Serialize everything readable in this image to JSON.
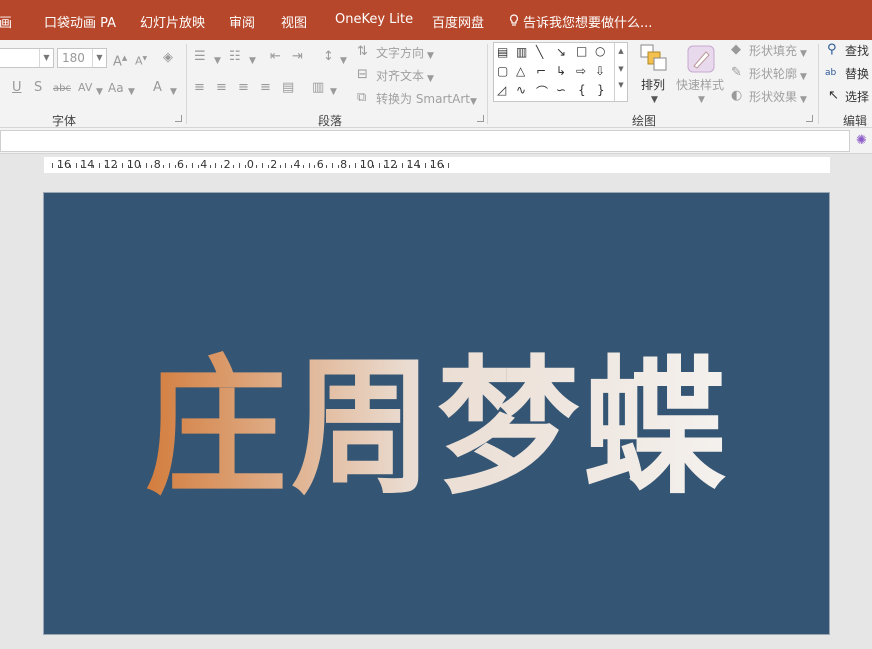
{
  "tabs": [
    "画",
    "口袋动画 PA",
    "幻灯片放映",
    "审阅",
    "视图",
    "OneKey Lite",
    "百度网盘"
  ],
  "tell_me": "告诉我您想要做什么...",
  "font": {
    "size_value": "180",
    "group_label": "字体"
  },
  "paragraph": {
    "group_label": "段落",
    "text_direction": "文字方向",
    "align_text": "对齐文本",
    "convert_smartart": "转换为 SmartArt"
  },
  "drawing": {
    "group_label": "绘图",
    "arrange": "排列",
    "quick_styles": "快速样式",
    "shape_fill": "形状填充",
    "shape_outline": "形状轮廓",
    "shape_effects": "形状效果"
  },
  "editing": {
    "group_label": "编辑",
    "find": "查找",
    "replace": "替换",
    "select": "选择"
  },
  "ruler_labels": [
    "16",
    "14",
    "12",
    "10",
    "8",
    "6",
    "4",
    "2",
    "0",
    "2",
    "4",
    "6",
    "8",
    "10",
    "12",
    "14",
    "16"
  ],
  "slide": {
    "title_text": "庄周梦蝶",
    "background": "#345573",
    "gradient": [
      "#cf7737",
      "#f1ede9"
    ]
  },
  "colors": {
    "ribbon_tab_bar": "#b7472a",
    "ribbon_bg": "#f3f3f3"
  }
}
